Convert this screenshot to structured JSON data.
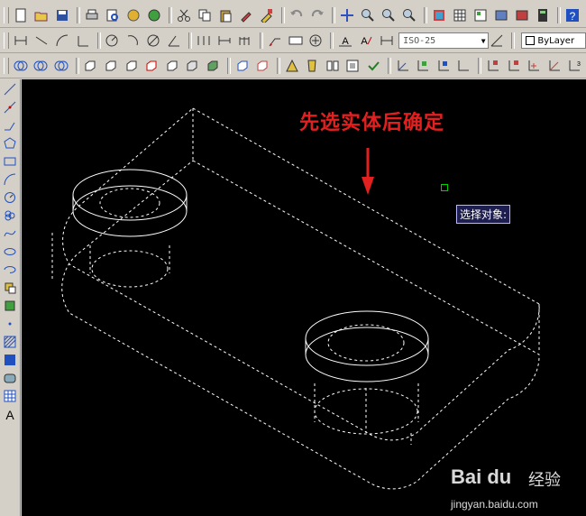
{
  "toolbars": {
    "dim_style": "ISO-25",
    "layer": "ByLayer"
  },
  "drawing": {
    "annotation": "先选实体后确定",
    "tooltip": "选择对象:"
  },
  "watermark": {
    "brand": "Bai du",
    "text": "经验",
    "url": "jingyan.baidu.com"
  },
  "colors": {
    "annotation": "#e22020",
    "canvas": "#000000",
    "tooltip_bg": "#1e1e50"
  }
}
